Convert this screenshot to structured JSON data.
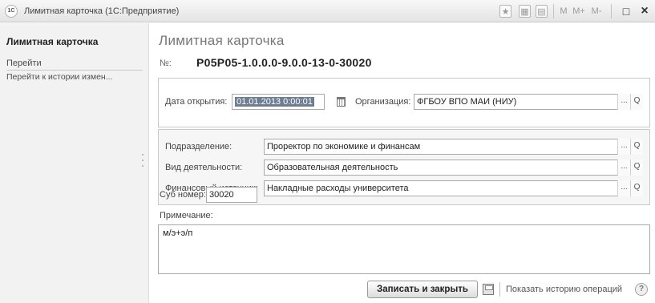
{
  "window": {
    "title": "Лимитная карточка  (1С:Предприятие)",
    "logo_text": "1С",
    "toolbar": {
      "m": "M",
      "m_plus": "M+",
      "m_minus": "M-",
      "restore": "□",
      "close": "×"
    }
  },
  "sidebar": {
    "title": "Лимитная карточка",
    "goto_label": "Перейти",
    "links": [
      "Перейти к истории измен..."
    ]
  },
  "form": {
    "title": "Лимитная карточка",
    "number_label": "№:",
    "number_value": "P05P05-1.0.0.0-9.0.0-13-0-30020",
    "open_date_label": "Дата открытия:",
    "open_date_value": "01.01.2013  0:00:01",
    "organization_label": "Организация:",
    "organization_value": "ФГБОУ ВПО МАИ (НИУ)",
    "department_label": "Подразделение:",
    "department_value": "Проректор по экономике и финансам",
    "activity_label": "Вид деятельности:",
    "activity_value": "Образовательная деятельность",
    "funding_label": "Финансовый источник:",
    "funding_value": "Накладные расходы университета",
    "sub_number_label": "Суб номер:",
    "sub_number_value": "30020",
    "note_label": "Примечание:",
    "note_value": "м/э+э/п",
    "select_button": "...",
    "open_button": "Q"
  },
  "actions": {
    "save_close": "Записать и закрыть",
    "history": "Показать историю операций",
    "help": "?"
  }
}
